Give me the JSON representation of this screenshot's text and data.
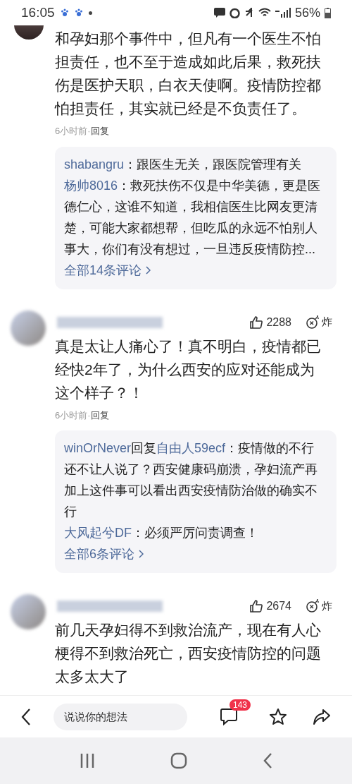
{
  "status_bar": {
    "time": "16:05",
    "battery": "56%"
  },
  "comments": [
    {
      "text": "和孕妇那个事件中，但凡有一个医生不怕担责任，也不至于造成如此后果，救死扶伤是医护天职，白衣天使啊。疫情防控都怕担责任，其实就已经是不负责任了。",
      "time": "6小时前",
      "separator": "·",
      "reply_action": "回复",
      "replies": [
        {
          "author": "shabangru",
          "text": "：跟医生无关，跟医院管理有关"
        },
        {
          "author": "杨帅8016",
          "text": "：救死扶伤不仅是中华美德，更是医德仁心，这谁不知道，我相信医生比网友更清楚，可能大家都想帮，但吃瓜的永远不怕别人事大，你们有没有想过，一旦违反疫情防控..."
        }
      ],
      "more": "全部14条评论"
    },
    {
      "likes": "2288",
      "bomb": "炸",
      "text": "真是太让人痛心了！真不明白，疫情都已经快2年了，为什么西安的应对还能成为这个样子？！",
      "time": "6小时前",
      "separator": "·",
      "reply_action": "回复",
      "replies": [
        {
          "author": "winOrNever",
          "reply_verb": "回复",
          "reply_to": "自由人59ecf",
          "text": "：疫情做的不行还不让人说了？西安健康码崩溃，孕妇流产再加上这件事可以看出西安疫情防治做的确实不行"
        },
        {
          "author": "大风起兮DF",
          "text": "：必须严厉问责调查！"
        }
      ],
      "more": "全部6条评论"
    },
    {
      "likes": "2674",
      "bomb": "炸",
      "text": "前几天孕妇得不到救治流产，现在有人心梗得不到救治死亡，西安疫情防控的问题太多太大了"
    }
  ],
  "bottom_bar": {
    "placeholder": "说说你的想法",
    "comment_count": "143"
  }
}
